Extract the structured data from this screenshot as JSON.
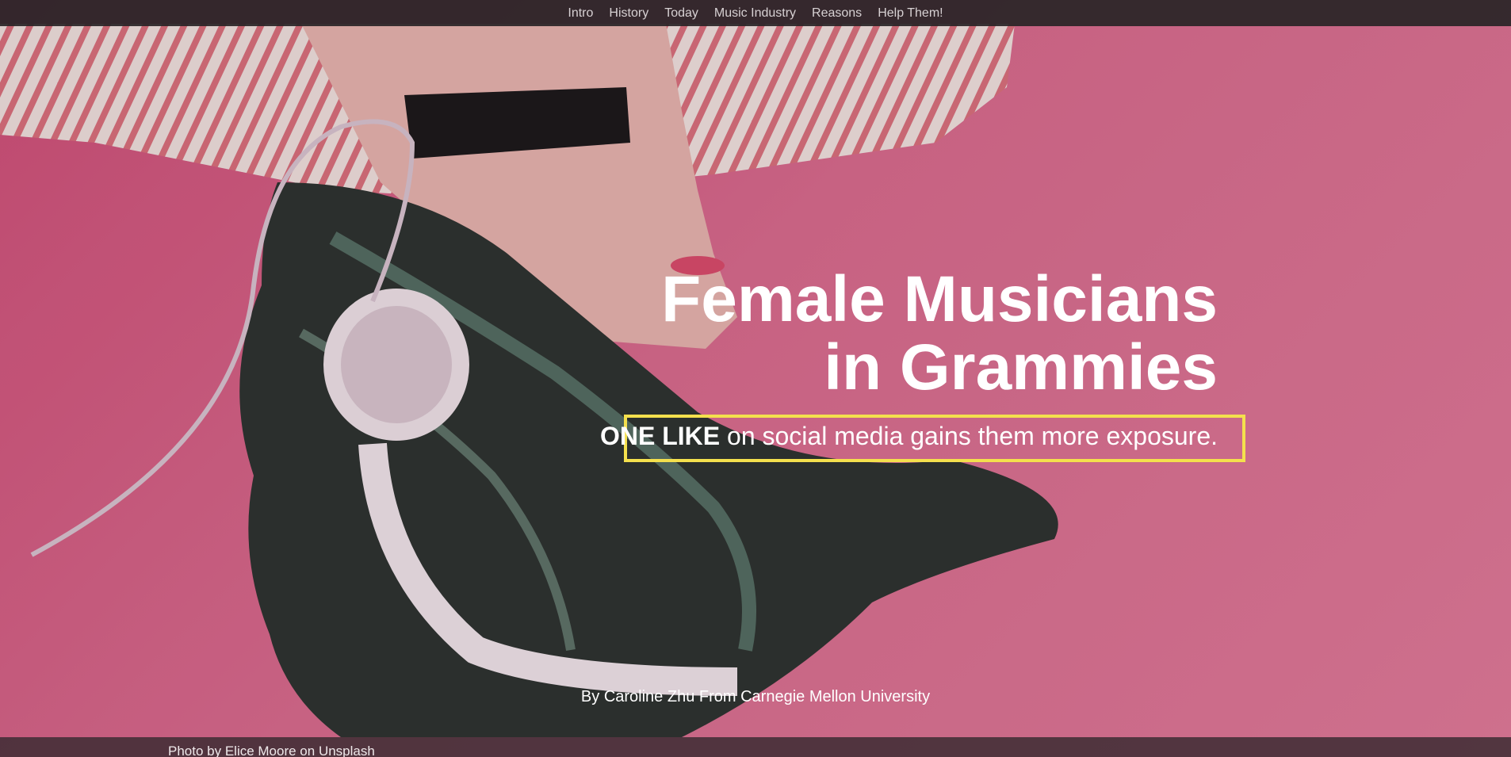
{
  "nav": {
    "items": [
      {
        "label": "Intro"
      },
      {
        "label": "History"
      },
      {
        "label": "Today"
      },
      {
        "label": "Music Industry"
      },
      {
        "label": "Reasons"
      },
      {
        "label": "Help Them!"
      }
    ]
  },
  "hero": {
    "title_line1": "Female Musicians",
    "title_line2": "in Grammies",
    "subtitle_strong": "ONE LIKE",
    "subtitle_rest": " on social media gains them more exposure.",
    "byline": "By Caroline Zhu From Carnegie Mellon University"
  },
  "footer": {
    "credit": "Photo by Elice Moore on Unsplash"
  },
  "colors": {
    "background_pink": "#d86b8e",
    "nav_bg": "#282426",
    "highlight_border": "#f4e04d",
    "text": "#ffffff"
  }
}
